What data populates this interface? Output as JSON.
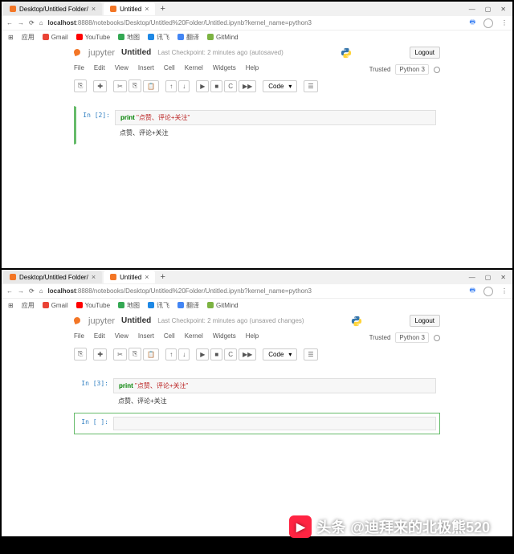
{
  "top": {
    "tabs": [
      {
        "title": "Desktop/Untitled Folder/"
      },
      {
        "title": "Untitled"
      }
    ],
    "url_pre": "localhost",
    "url_port": ":8888",
    "url_path": "/notebooks/Desktop/Untitled%20Folder/Untitled.ipynb?kernel_name=python3",
    "bookmarks": [
      "应用",
      "Gmail",
      "YouTube",
      "地图",
      "讯飞",
      "翻译",
      "GitMind"
    ],
    "logo": "jupyter",
    "title": "Untitled",
    "checkpoint": "Last Checkpoint: 2 minutes ago (autosaved)",
    "logout": "Logout",
    "trusted": "Trusted",
    "kernel": "Python 3",
    "menu": [
      "File",
      "Edit",
      "View",
      "Insert",
      "Cell",
      "Kernel",
      "Widgets",
      "Help"
    ],
    "toolbar": {
      "save": "⎘",
      "add": "✚",
      "cut": "✂",
      "copy": "⎘",
      "paste": "📋",
      "up": "↑",
      "down": "↓",
      "run": "▶",
      "stop": "■",
      "restart": "C",
      "fwd": "▶▶",
      "type": "Code",
      "cmd": "☰"
    },
    "cell": {
      "prompt": "In [2]:",
      "kw": "print",
      "str": "\"点赞、评论+关注\"",
      "out": "点赞、评论+关注"
    }
  },
  "bottom": {
    "tabs": [
      {
        "title": "Desktop/Untitled Folder/"
      },
      {
        "title": "Untitled"
      }
    ],
    "url_pre": "localhost",
    "url_port": ":8888",
    "url_path": "/notebooks/Desktop/Untitled%20Folder/Untitled.ipynb?kernel_name=python3",
    "bookmarks": [
      "应用",
      "Gmail",
      "YouTube",
      "地图",
      "讯飞",
      "翻译",
      "GitMind"
    ],
    "logo": "jupyter",
    "title": "Untitled",
    "checkpoint": "Last Checkpoint: 2 minutes ago (unsaved changes)",
    "logout": "Logout",
    "trusted": "Trusted",
    "kernel": "Python 3",
    "menu": [
      "File",
      "Edit",
      "View",
      "Insert",
      "Cell",
      "Kernel",
      "Widgets",
      "Help"
    ],
    "toolbar": {
      "save": "⎘",
      "add": "✚",
      "cut": "✂",
      "copy": "⎘",
      "paste": "📋",
      "up": "↑",
      "down": "↓",
      "run": "▶",
      "stop": "■",
      "restart": "C",
      "fwd": "▶▶",
      "type": "Code",
      "cmd": "☰"
    },
    "cell1": {
      "prompt": "In [3]:",
      "kw": "print",
      "str": "\"点赞、评论+关注\"",
      "out": "点赞、评论+关注"
    },
    "cell2": {
      "prompt": "In [ ]:"
    }
  },
  "watermark": {
    "prefix": "头条",
    "handle": "@迪拜来的北极熊520"
  }
}
